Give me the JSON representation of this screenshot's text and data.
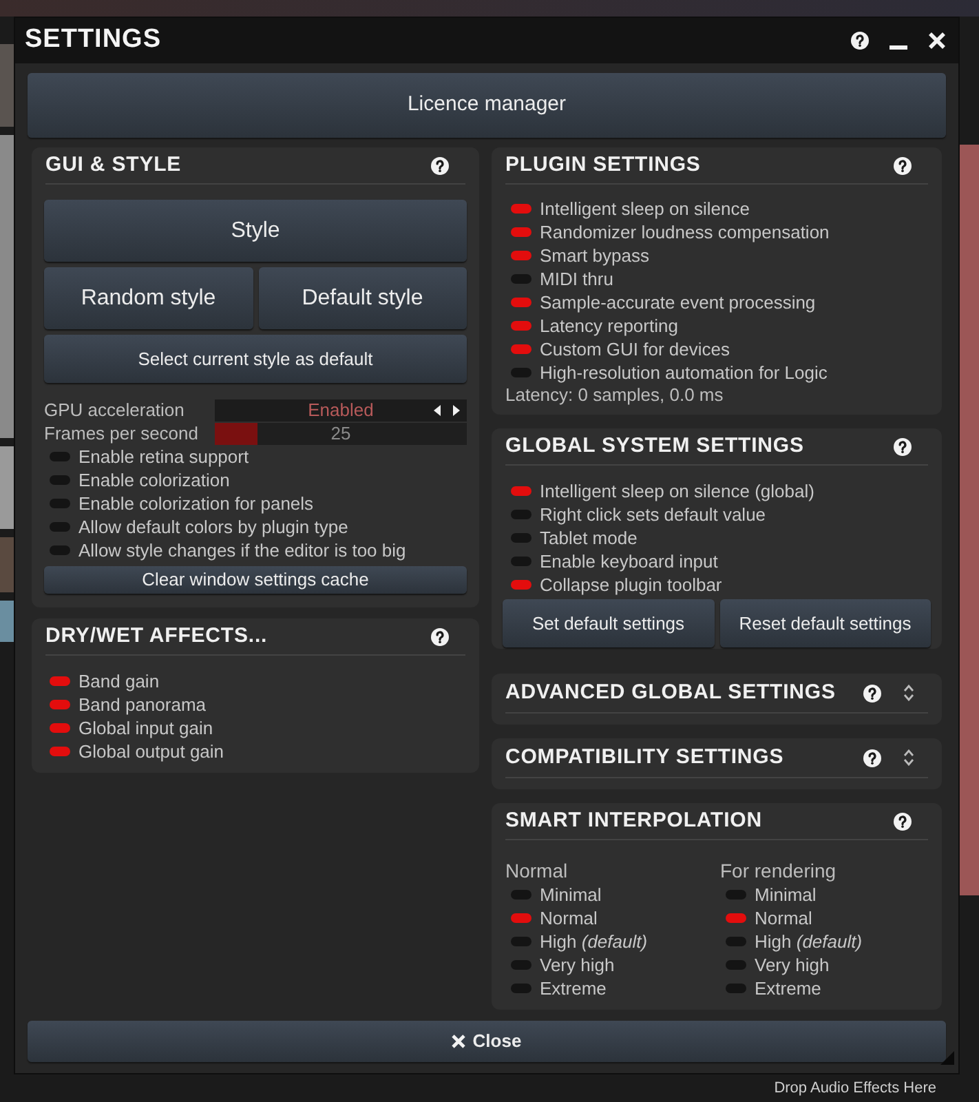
{
  "window": {
    "title": "SETTINGS"
  },
  "licence_button": {
    "label": "Licence manager"
  },
  "gui_style": {
    "title": "GUI & STYLE",
    "style_button": "Style",
    "random_button": "Random style",
    "default_button": "Default style",
    "select_default_button": "Select current style as default",
    "gpu": {
      "label": "GPU acceleration",
      "value": "Enabled"
    },
    "fps": {
      "label": "Frames per second",
      "value": "25",
      "level": 0.17
    },
    "toggles": [
      {
        "label": "Enable retina support",
        "on": false
      },
      {
        "label": "Enable colorization",
        "on": false
      },
      {
        "label": "Enable colorization for panels",
        "on": false
      },
      {
        "label": "Allow default colors by plugin type",
        "on": false
      },
      {
        "label": "Allow style changes if the editor is too big",
        "on": false
      }
    ],
    "clear_button": "Clear window settings cache"
  },
  "dry_wet": {
    "title": "DRY/WET AFFECTS...",
    "toggles": [
      {
        "label": "Band gain",
        "on": true
      },
      {
        "label": "Band panorama",
        "on": true
      },
      {
        "label": "Global input gain",
        "on": true
      },
      {
        "label": "Global output gain",
        "on": true
      }
    ]
  },
  "plugin_settings": {
    "title": "PLUGIN SETTINGS",
    "toggles": [
      {
        "label": "Intelligent sleep on silence",
        "on": true
      },
      {
        "label": "Randomizer loudness compensation",
        "on": true
      },
      {
        "label": "Smart bypass",
        "on": true
      },
      {
        "label": "MIDI thru",
        "on": false
      },
      {
        "label": "Sample-accurate event processing",
        "on": true
      },
      {
        "label": "Latency reporting",
        "on": true
      },
      {
        "label": "Custom GUI for devices",
        "on": true
      },
      {
        "label": "High-resolution automation for Logic",
        "on": false
      }
    ],
    "latency": "Latency: 0 samples, 0.0 ms"
  },
  "global_system": {
    "title": "GLOBAL SYSTEM SETTINGS",
    "toggles": [
      {
        "label": "Intelligent sleep on silence (global)",
        "on": true
      },
      {
        "label": "Right click sets default value",
        "on": false
      },
      {
        "label": "Tablet mode",
        "on": false
      },
      {
        "label": "Enable keyboard input",
        "on": false
      },
      {
        "label": "Collapse plugin toolbar",
        "on": true
      }
    ],
    "buttons": [
      "Set default settings",
      "Reset default settings"
    ]
  },
  "advanced_global": {
    "title": "ADVANCED GLOBAL SETTINGS",
    "expanded": false
  },
  "compatibility": {
    "title": "COMPATIBILITY SETTINGS",
    "expanded": false
  },
  "smart_interpolation": {
    "title": "SMART INTERPOLATION",
    "columns": [
      {
        "heading": "Normal",
        "options": [
          {
            "label": "Minimal",
            "selected": false
          },
          {
            "label": "Normal",
            "selected": true
          },
          {
            "label": "High *(default)*",
            "selected": false
          },
          {
            "label": "Very high",
            "selected": false
          },
          {
            "label": "Extreme",
            "selected": false
          }
        ]
      },
      {
        "heading": "For rendering",
        "options": [
          {
            "label": "Minimal",
            "selected": false
          },
          {
            "label": "Normal",
            "selected": true
          },
          {
            "label": "High *(default)*",
            "selected": false
          },
          {
            "label": "Very high",
            "selected": false
          },
          {
            "label": "Extreme",
            "selected": false
          }
        ]
      }
    ]
  },
  "close_button": {
    "label": "Close"
  },
  "host": {
    "drop_hint": "Drop Audio Effects Here"
  }
}
